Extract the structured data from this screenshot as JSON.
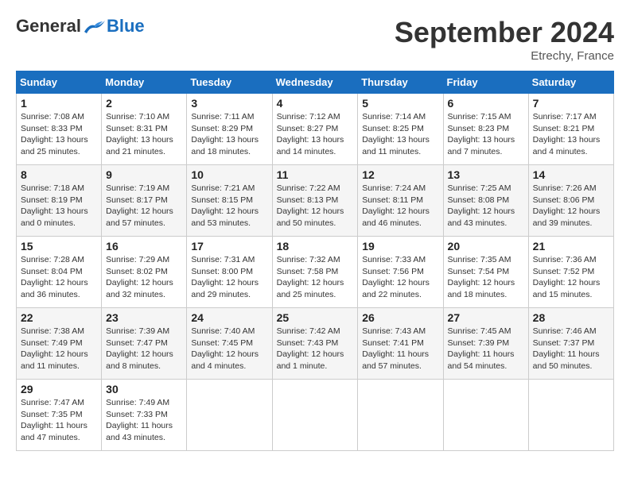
{
  "header": {
    "logo_general": "General",
    "logo_blue": "Blue",
    "month_title": "September 2024",
    "location": "Etrechy, France"
  },
  "days_of_week": [
    "Sunday",
    "Monday",
    "Tuesday",
    "Wednesday",
    "Thursday",
    "Friday",
    "Saturday"
  ],
  "weeks": [
    [
      {
        "day": "1",
        "sunrise": "7:08 AM",
        "sunset": "8:33 PM",
        "daylight": "13 hours and 25 minutes."
      },
      {
        "day": "2",
        "sunrise": "7:10 AM",
        "sunset": "8:31 PM",
        "daylight": "13 hours and 21 minutes."
      },
      {
        "day": "3",
        "sunrise": "7:11 AM",
        "sunset": "8:29 PM",
        "daylight": "13 hours and 18 minutes."
      },
      {
        "day": "4",
        "sunrise": "7:12 AM",
        "sunset": "8:27 PM",
        "daylight": "13 hours and 14 minutes."
      },
      {
        "day": "5",
        "sunrise": "7:14 AM",
        "sunset": "8:25 PM",
        "daylight": "13 hours and 11 minutes."
      },
      {
        "day": "6",
        "sunrise": "7:15 AM",
        "sunset": "8:23 PM",
        "daylight": "13 hours and 7 minutes."
      },
      {
        "day": "7",
        "sunrise": "7:17 AM",
        "sunset": "8:21 PM",
        "daylight": "13 hours and 4 minutes."
      }
    ],
    [
      {
        "day": "8",
        "sunrise": "7:18 AM",
        "sunset": "8:19 PM",
        "daylight": "13 hours and 0 minutes."
      },
      {
        "day": "9",
        "sunrise": "7:19 AM",
        "sunset": "8:17 PM",
        "daylight": "12 hours and 57 minutes."
      },
      {
        "day": "10",
        "sunrise": "7:21 AM",
        "sunset": "8:15 PM",
        "daylight": "12 hours and 53 minutes."
      },
      {
        "day": "11",
        "sunrise": "7:22 AM",
        "sunset": "8:13 PM",
        "daylight": "12 hours and 50 minutes."
      },
      {
        "day": "12",
        "sunrise": "7:24 AM",
        "sunset": "8:11 PM",
        "daylight": "12 hours and 46 minutes."
      },
      {
        "day": "13",
        "sunrise": "7:25 AM",
        "sunset": "8:08 PM",
        "daylight": "12 hours and 43 minutes."
      },
      {
        "day": "14",
        "sunrise": "7:26 AM",
        "sunset": "8:06 PM",
        "daylight": "12 hours and 39 minutes."
      }
    ],
    [
      {
        "day": "15",
        "sunrise": "7:28 AM",
        "sunset": "8:04 PM",
        "daylight": "12 hours and 36 minutes."
      },
      {
        "day": "16",
        "sunrise": "7:29 AM",
        "sunset": "8:02 PM",
        "daylight": "12 hours and 32 minutes."
      },
      {
        "day": "17",
        "sunrise": "7:31 AM",
        "sunset": "8:00 PM",
        "daylight": "12 hours and 29 minutes."
      },
      {
        "day": "18",
        "sunrise": "7:32 AM",
        "sunset": "7:58 PM",
        "daylight": "12 hours and 25 minutes."
      },
      {
        "day": "19",
        "sunrise": "7:33 AM",
        "sunset": "7:56 PM",
        "daylight": "12 hours and 22 minutes."
      },
      {
        "day": "20",
        "sunrise": "7:35 AM",
        "sunset": "7:54 PM",
        "daylight": "12 hours and 18 minutes."
      },
      {
        "day": "21",
        "sunrise": "7:36 AM",
        "sunset": "7:52 PM",
        "daylight": "12 hours and 15 minutes."
      }
    ],
    [
      {
        "day": "22",
        "sunrise": "7:38 AM",
        "sunset": "7:49 PM",
        "daylight": "12 hours and 11 minutes."
      },
      {
        "day": "23",
        "sunrise": "7:39 AM",
        "sunset": "7:47 PM",
        "daylight": "12 hours and 8 minutes."
      },
      {
        "day": "24",
        "sunrise": "7:40 AM",
        "sunset": "7:45 PM",
        "daylight": "12 hours and 4 minutes."
      },
      {
        "day": "25",
        "sunrise": "7:42 AM",
        "sunset": "7:43 PM",
        "daylight": "12 hours and 1 minute."
      },
      {
        "day": "26",
        "sunrise": "7:43 AM",
        "sunset": "7:41 PM",
        "daylight": "11 hours and 57 minutes."
      },
      {
        "day": "27",
        "sunrise": "7:45 AM",
        "sunset": "7:39 PM",
        "daylight": "11 hours and 54 minutes."
      },
      {
        "day": "28",
        "sunrise": "7:46 AM",
        "sunset": "7:37 PM",
        "daylight": "11 hours and 50 minutes."
      }
    ],
    [
      {
        "day": "29",
        "sunrise": "7:47 AM",
        "sunset": "7:35 PM",
        "daylight": "11 hours and 47 minutes."
      },
      {
        "day": "30",
        "sunrise": "7:49 AM",
        "sunset": "7:33 PM",
        "daylight": "11 hours and 43 minutes."
      },
      null,
      null,
      null,
      null,
      null
    ]
  ]
}
